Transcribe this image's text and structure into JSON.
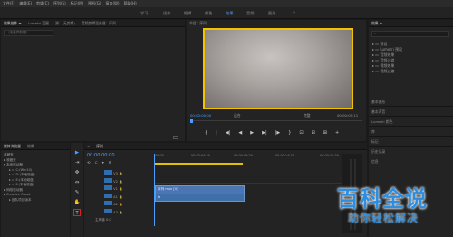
{
  "menu": [
    "文件(F)",
    "编辑(E)",
    "剪辑(C)",
    "序列(S)",
    "标记(M)",
    "图形(G)",
    "窗口(W)",
    "帮助(H)"
  ],
  "workspaces": [
    {
      "label": "学习",
      "active": false
    },
    {
      "label": "组件",
      "active": false
    },
    {
      "label": "编辑",
      "active": false
    },
    {
      "label": "颜色",
      "active": false
    },
    {
      "label": "效果",
      "active": true
    },
    {
      "label": "音频",
      "active": false
    },
    {
      "label": "图形",
      "active": false
    }
  ],
  "workspace_more": "»",
  "source_panel": {
    "tabs": [
      "效果控件 ≡",
      "Lumetri 范围",
      "源：(无剪辑)",
      "音频剪辑混合器：序列"
    ],
    "empty_text": "（未选择剪辑）"
  },
  "program_panel": {
    "title": "节目：序列",
    "timecode_left": "00:00:00:00",
    "fit_label": "适合",
    "quality_label": "完整",
    "timecode_right": "00:00:05:11",
    "transport": [
      "{",
      "|",
      "◀|",
      "◀",
      "▶",
      "▶|",
      "|▶",
      "}",
      "⊡",
      "⊟",
      "⊞",
      "+"
    ]
  },
  "effects_panel": {
    "title": "效果 ≡",
    "items": [
      "预设",
      "Lumetri 预设",
      "音频效果",
      "音频过渡",
      "视频效果",
      "视频过渡"
    ],
    "sections": [
      "基本图形",
      "基本声音",
      "Lumetri 颜色",
      "库",
      "标记",
      "历史记录",
      "信息"
    ]
  },
  "project_panel": {
    "tabs": [
      "媒体浏览器",
      "效果"
    ],
    "heading": "收藏夹",
    "tree": [
      "收藏夹",
      "本地驱动器",
      "C:(Win10)",
      "D:(本地磁盘)",
      "E:(本地磁盘)",
      "F:(本地磁盘)",
      "网络驱动器",
      "Creative Cloud",
      "团队项目版本"
    ]
  },
  "timeline": {
    "close": "×",
    "tab": "序列",
    "timecode": "00:00:00:00",
    "ruler": [
      "00:00",
      "00:00:04:29",
      "00:00:09:29",
      "00:00:14:29",
      "00:00:19:29"
    ],
    "tracks": [
      "V3",
      "V2",
      "V1",
      "A1",
      "A2",
      "A3"
    ],
    "master_label": "主声道",
    "master_value": "0.0",
    "clip_video": "序列 mov [V]",
    "clip_audio": "fx"
  },
  "tools": [
    "▶",
    "⇥",
    "✥",
    "⇔",
    "✎",
    "✋",
    "T"
  ],
  "watermark": {
    "main": "百科全说",
    "sub": "助你轻松解决"
  }
}
